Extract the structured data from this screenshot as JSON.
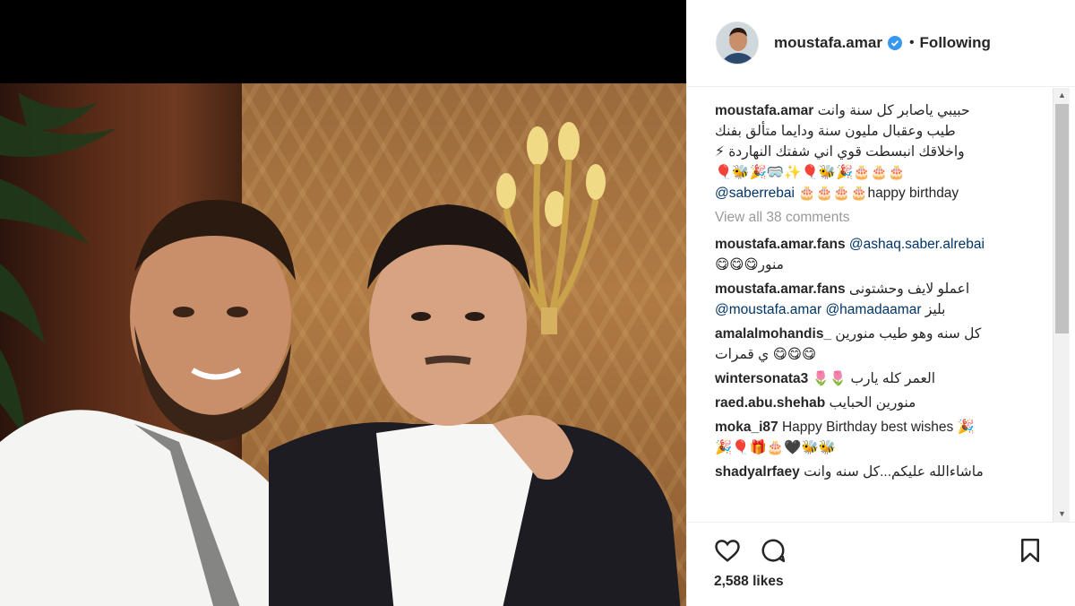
{
  "post": {
    "username": "moustafa.amar",
    "follow_status": "Following",
    "separator": "•",
    "likes": "2,588 likes"
  },
  "caption": {
    "username": "moustafa.amar",
    "line1": "حبيبي ياصابر كل سنة وانت",
    "line2": "طيب وعقبال مليون سنة ودايما متألق بفنك",
    "line3": "واخلاقك انبسطت قوي اني شفتك النهاردة ⚡",
    "line4": "🎈🐝🎉🥽✨🎈🐝🎉🎂🎂🎂",
    "mention": "@saberrebai",
    "line5_emoji": "🎂🎂🎂🎂",
    "line5_text": "happy birthday"
  },
  "view_all": "View all 38 comments",
  "comments": [
    {
      "username": "moustafa.amar.fans",
      "mention": "@ashaq.saber.alrebai",
      "text": "منور😋😋😋"
    },
    {
      "username": "moustafa.amar.fans",
      "text": "اعملو لايف وحشتونى",
      "mentions": [
        "@moustafa.amar",
        "@hamadaamar"
      ],
      "tail": "بليز"
    },
    {
      "username": "amalalmohandis_",
      "text": "كل سنه وهو طيب منورين",
      "text2": "😋😋😋 ي قمرات"
    },
    {
      "username": "wintersonata3",
      "text": "العمر كله يارب 🌷🌷"
    },
    {
      "username": "raed.abu.shehab",
      "text": "منورين الحبايب"
    },
    {
      "username": "moka_i87",
      "text": "Happy Birthday best wishes 🎉",
      "text2": "🎉🎈🎁🎂🖤🐝🐝"
    },
    {
      "username": "shadyalrfaey",
      "text": "ماشاءالله عليكم...كل سنه وانت"
    }
  ],
  "icons": {
    "like": "heart-icon",
    "comment": "comment-icon",
    "save": "bookmark-icon",
    "verified": "verified-badge-icon"
  },
  "colors": {
    "verified": "#3897f0",
    "mention": "#003569",
    "muted": "#999999"
  }
}
